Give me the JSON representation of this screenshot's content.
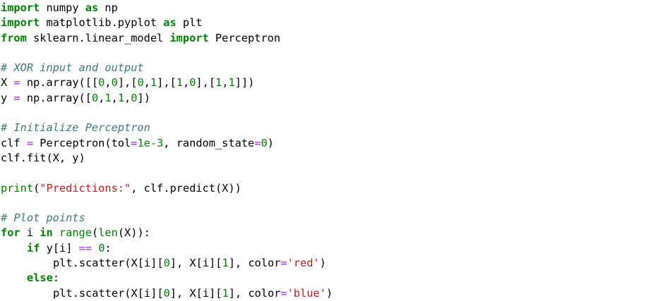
{
  "code": {
    "line1": {
      "kw_import": "import",
      "t1": " numpy ",
      "kw_as": "as",
      "t2": " np"
    },
    "line2": {
      "kw_import": "import",
      "t1": " matplotlib.pyplot ",
      "kw_as": "as",
      "t2": " plt"
    },
    "line3": {
      "kw_from": "from",
      "t1": " sklearn.linear_model ",
      "kw_import": "import",
      "t2": " Perceptron"
    },
    "line5": {
      "comment": "# XOR input and output"
    },
    "line6": {
      "t1": "X ",
      "op": "=",
      "t2": " np.array([[",
      "n1": "0",
      "c1": ",",
      "n2": "0",
      "t3": "],[",
      "n3": "0",
      "c2": ",",
      "n4": "1",
      "t4": "],[",
      "n5": "1",
      "c3": ",",
      "n6": "0",
      "t5": "],[",
      "n7": "1",
      "c4": ",",
      "n8": "1",
      "t6": "]])"
    },
    "line7": {
      "t1": "y ",
      "op": "=",
      "t2": " np.array([",
      "n1": "0",
      "c1": ",",
      "n2": "1",
      "c2": ",",
      "n3": "1",
      "c3": ",",
      "n4": "0",
      "t3": "])"
    },
    "line9": {
      "comment": "# Initialize Perceptron"
    },
    "line10": {
      "t1": "clf ",
      "op": "=",
      "t2": " Perceptron(tol",
      "op2": "=",
      "n1": "1e-3",
      "t3": ", random_state",
      "op3": "=",
      "n2": "0",
      "t4": ")"
    },
    "line11": {
      "t1": "clf.fit(X, y)"
    },
    "line13": {
      "bi": "print",
      "t1": "(",
      "str": "\"Predictions:\"",
      "t2": ", clf.predict(X))"
    },
    "line15": {
      "comment": "# Plot points"
    },
    "line16": {
      "kw_for": "for",
      "t1": " i ",
      "kw_in": "in",
      "t2": " ",
      "bi1": "range",
      "t3": "(",
      "bi2": "len",
      "t4": "(X)):"
    },
    "line17": {
      "kw_if": "if",
      "t1": " y[i] ",
      "op": "==",
      "t2": " ",
      "n1": "0",
      "t3": ":"
    },
    "line18": {
      "t1": "plt.scatter(X[i][",
      "n1": "0",
      "t2": "], X[i][",
      "n2": "1",
      "t3": "], color",
      "op": "=",
      "str": "'red'",
      "t4": ")"
    },
    "line19": {
      "kw_else": "else",
      "t1": ":"
    },
    "line20": {
      "t1": "plt.scatter(X[i][",
      "n1": "0",
      "t2": "], X[i][",
      "n2": "1",
      "t3": "], color",
      "op": "=",
      "str": "'blue'",
      "t4": ")"
    }
  },
  "colors": {
    "keyword": "#008000",
    "comment": "#3d7b7b",
    "operator": "#aa22ff",
    "number": "#008000",
    "string": "#ba2121",
    "text": "#000000",
    "background": "#ffffff"
  }
}
